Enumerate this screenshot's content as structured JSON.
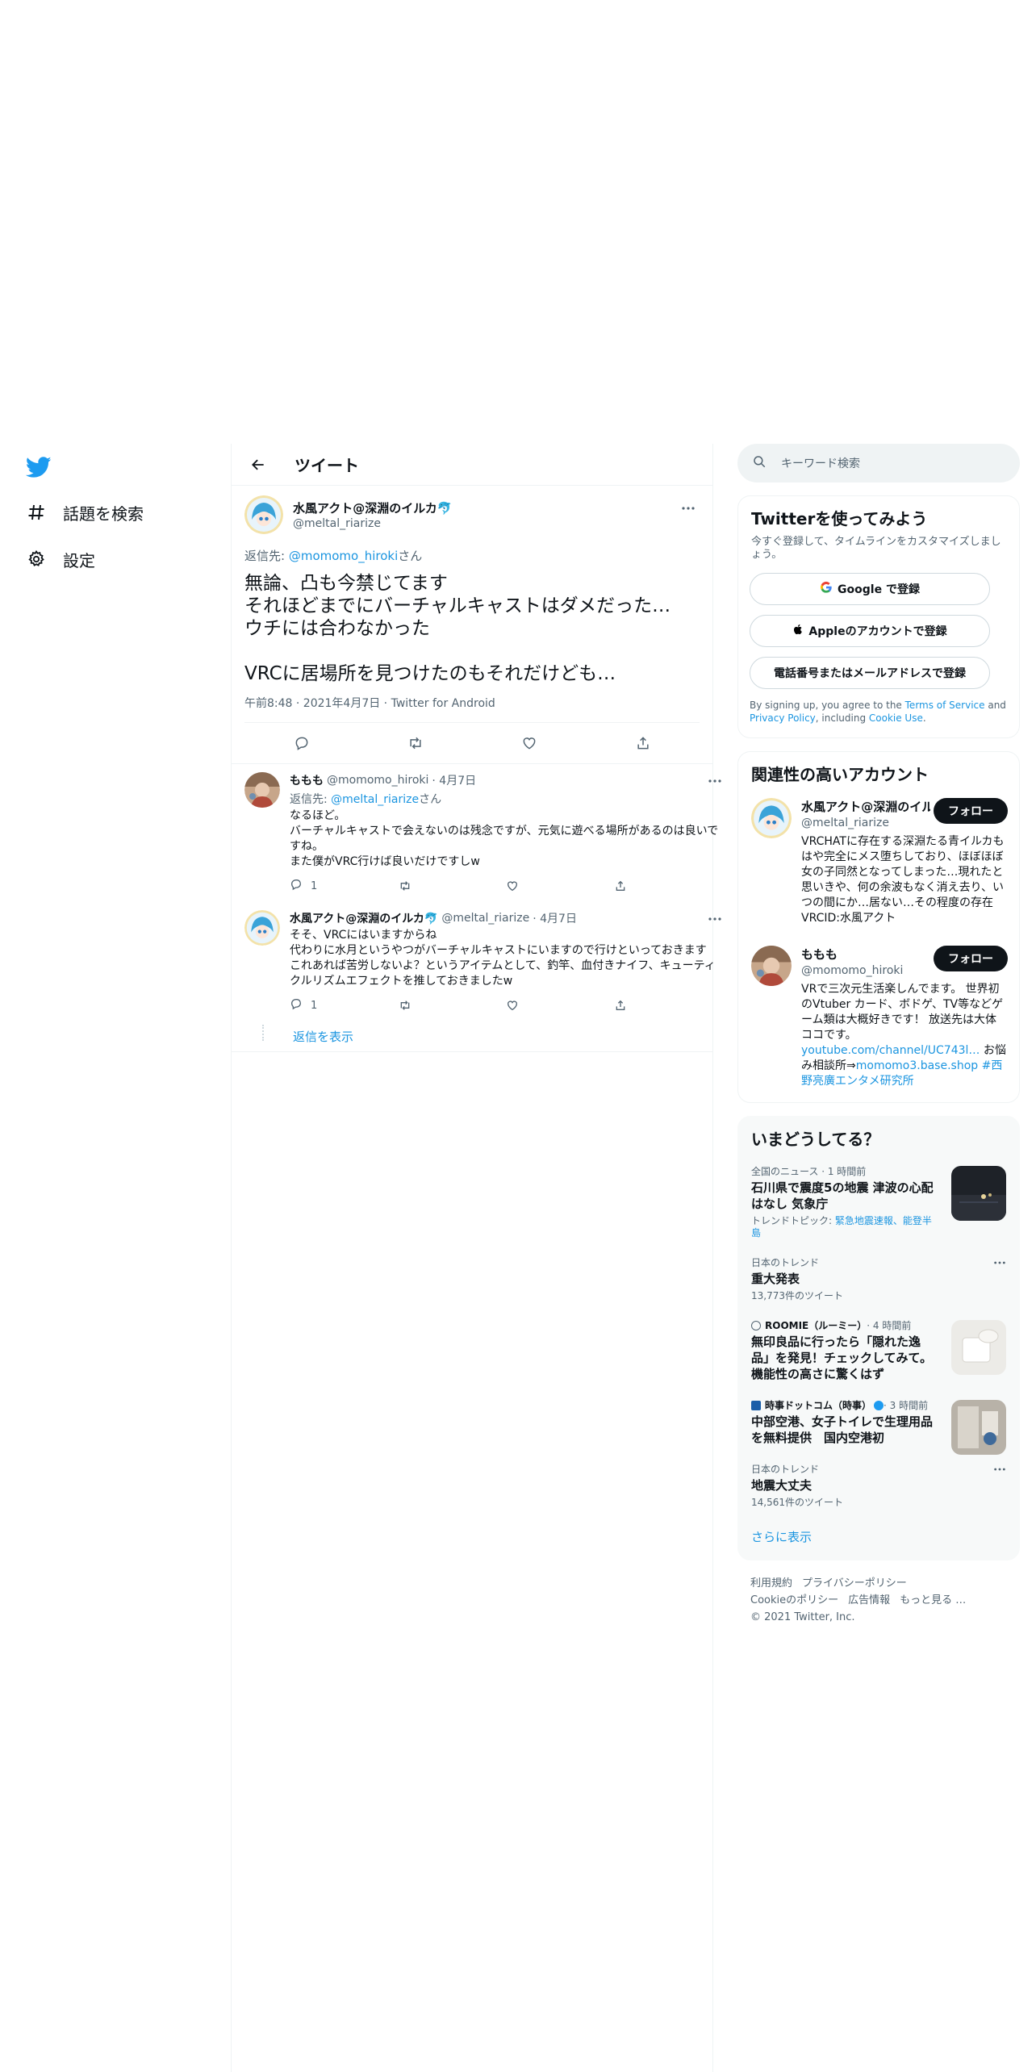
{
  "nav": {
    "items": [
      {
        "icon": "hashtag-icon",
        "label": "話題を検索"
      },
      {
        "icon": "gear-icon",
        "label": "設定"
      }
    ]
  },
  "header": {
    "title": "ツイート"
  },
  "focal": {
    "name": "水風アクト@深淵のイルカ🐬",
    "handle": "@meltal_riarize",
    "reply_prefix": "返信先: ",
    "reply_handle": "@momomo_hiroki",
    "reply_suffix": "さん",
    "text": "無論、凸も今禁じてます\nそれほどまでにバーチャルキャストはダメだった…\nウチには合わなかった\n\nVRCに居場所を見つけたのもそれだけども…",
    "meta": "午前8:48 · 2021年4月7日 · Twitter for Android"
  },
  "replies": [
    {
      "name": "ももも",
      "handle": "@momomo_hiroki",
      "date": "· 4月7日",
      "reply_prefix": "返信先: ",
      "reply_handle": "@meltal_riarize",
      "reply_suffix": "さん",
      "text": "なるほど。\nバーチャルキャストで会えないのは残念ですが、元気に遊べる場所があるのは良いですね。\nまた僕がVRC行けば良いだけですしw",
      "reply_count": "1"
    },
    {
      "name": "水風アクト@深淵のイルカ🐬",
      "handle": "@meltal_riarize",
      "date": "· 4月7日",
      "text": "そそ、VRCにはいますからね\n代わりに水月というやつがバーチャルキャストにいますので行けといっておきます\nこれあれば苦労しないよ？というアイテムとして、釣竿、血付きナイフ、キューティクルリズムエフェクトを推しておきましたw",
      "reply_count": "1"
    }
  ],
  "show_replies": "返信を表示",
  "search": {
    "placeholder": "キーワード検索"
  },
  "signup": {
    "title": "Twitterを使ってみよう",
    "subtitle": "今すぐ登録して、タイムラインをカスタマイズしましょう。",
    "google": "Google で登録",
    "apple": "Appleのアカウントで登録",
    "phone": "電話番号またはメールアドレスで登録",
    "terms_pre": "By signing up, you agree to the ",
    "terms_link": "Terms of Service",
    "terms_and": " and ",
    "privacy_link": "Privacy Policy",
    "terms_incl": ", including ",
    "cookie_link": "Cookie Use",
    "terms_end": "."
  },
  "related": {
    "title": "関連性の高いアカウント",
    "follow_label": "フォロー",
    "accounts": [
      {
        "name": "水風アクト@深淵のイル",
        "handle": "@meltal_riarize",
        "bio": "VRCHATに存在する深淵たる青イルカもはや完全にメス堕ちしており、ほぼほぼ女の子同然となってしまった…現れたと思いきや、何の余波もなく消え去り、いつの間にか…居ない…その程度の存在 VRCID:水風アクト"
      },
      {
        "name": "ももも",
        "handle": "@momomo_hiroki",
        "bio_text": "VRで三次元生活楽しんでます。 世界初のVtuber カード、ボドゲ、TV等などゲーム類は大概好きです！ 放送先は大体ココです。",
        "bio_link1": "youtube.com/channel/UC743l…",
        "bio_mid": " お悩み相談所⇒",
        "bio_link2": "momomo3.base.shop",
        "bio_tag": " #西野亮廣エンタメ研究所"
      }
    ]
  },
  "trends": {
    "title": "いまどうしてる？",
    "items": [
      {
        "context": "全国のニュース · 1 時間前",
        "title": "石川県で震度5の地震 津波の心配はなし 気象庁",
        "sub_label": "トレンドトピック: ",
        "sub_links": "緊急地震速報、能登半島",
        "image": "night-coast-image"
      },
      {
        "context": "日本のトレンド",
        "title": "重大発表",
        "count": "13,773件のツイート"
      },
      {
        "source": "ROOMIE（ルーミー）",
        "time": " · 4 時間前",
        "title": "無印良品に行ったら「隠れた逸品」を発見！チェックしてみて。機能性の高さに驚くはず",
        "image": "muji-product-image"
      },
      {
        "source": "時事ドットコム（時事）",
        "time": " · 3 時間前",
        "title": "中部空港、女子トイレで生理用品を無料提供　国内空港初",
        "image": "restroom-image"
      },
      {
        "context": "日本のトレンド",
        "title": "地震大丈夫",
        "count": "14,561件のツイート"
      }
    ],
    "show_more": "さらに表示"
  },
  "footer": {
    "links": [
      "利用規約",
      "プライバシーポリシー",
      "Cookieのポリシー",
      "広告情報",
      "もっと見る …"
    ],
    "copyright": "© 2021 Twitter, Inc."
  },
  "colors": {
    "accent": "#1b95e0",
    "text": "#0f1419",
    "muted": "#536471",
    "border": "#eff3f4"
  }
}
